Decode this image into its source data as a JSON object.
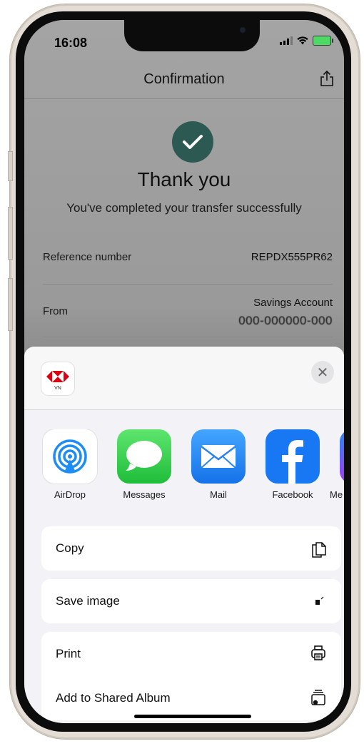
{
  "status_bar": {
    "time": "16:08"
  },
  "header": {
    "title": "Confirmation"
  },
  "confirmation": {
    "heading": "Thank you",
    "message": "You've completed your transfer successfully"
  },
  "details": [
    {
      "label": "Reference number",
      "value": "REPDX555PR62"
    },
    {
      "label": "From",
      "value_line1": "Savings Account",
      "value_line2": "000-000000-000"
    }
  ],
  "share_sheet": {
    "source_app_caption": "VN",
    "apps": [
      {
        "name": "AirDrop",
        "icon": "airdrop-icon",
        "color": "#2a8cf0"
      },
      {
        "name": "Messages",
        "icon": "messages-icon",
        "color": "#32c24d"
      },
      {
        "name": "Mail",
        "icon": "mail-icon",
        "color": "#1f8df5"
      },
      {
        "name": "Facebook",
        "icon": "facebook-icon",
        "color": "#1877f2"
      },
      {
        "name": "Me",
        "icon": "messenger-icon",
        "color": "#a23cf5"
      }
    ],
    "actions": [
      {
        "label": "Copy",
        "icon": "copy-icon"
      },
      {
        "label": "Save image",
        "icon": "save-image-icon"
      },
      {
        "label": "Print",
        "icon": "print-icon"
      },
      {
        "label": "Add to Shared Album",
        "icon": "shared-album-icon"
      }
    ]
  },
  "colors": {
    "brand_red": "#db0011",
    "check_green": "#2c5a52"
  }
}
